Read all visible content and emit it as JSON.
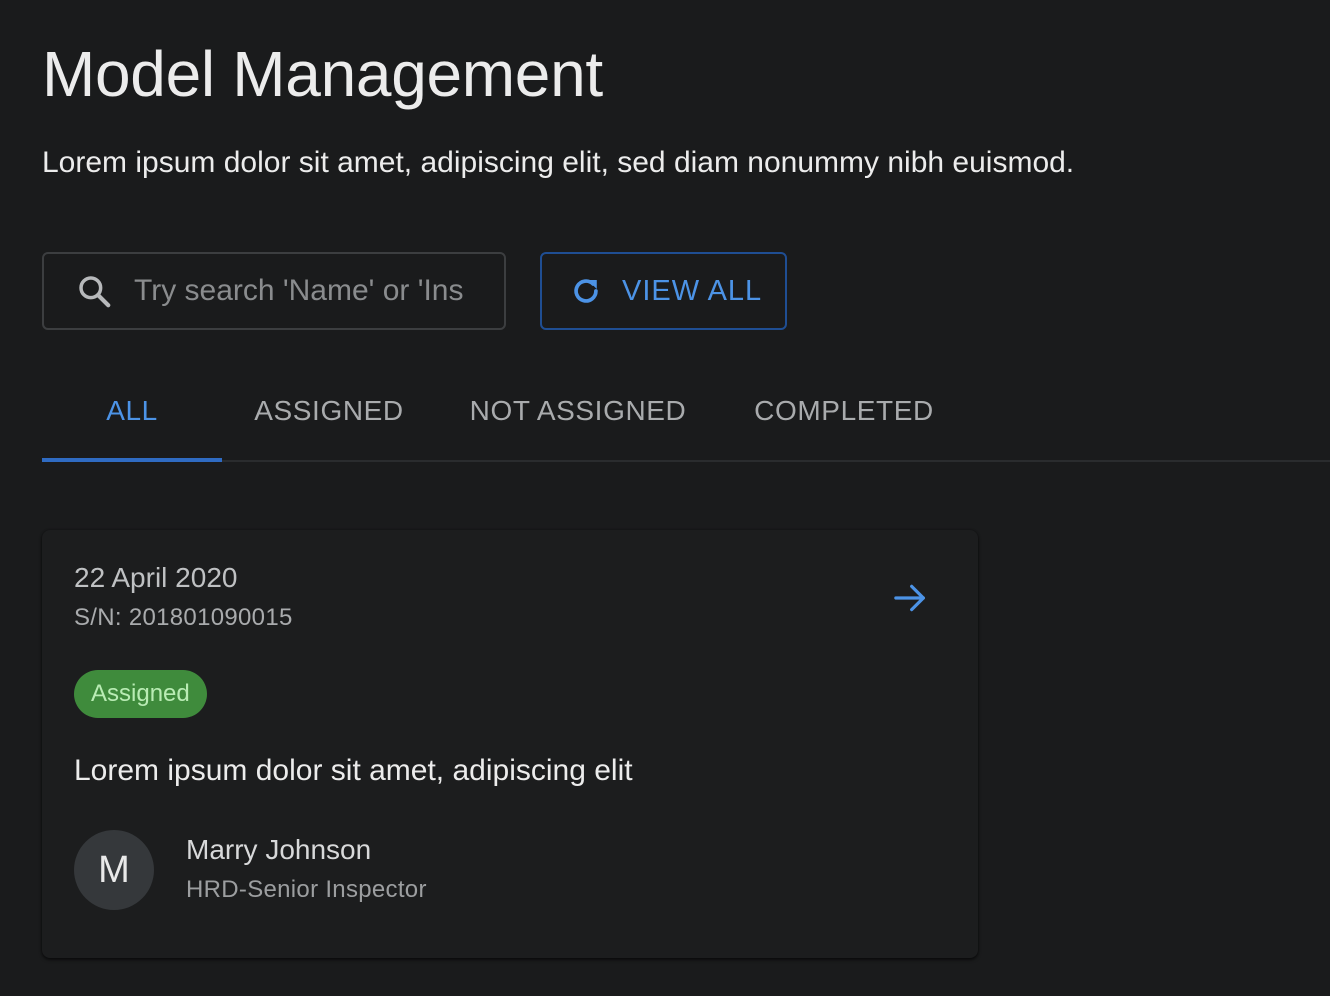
{
  "header": {
    "title": "Model Management",
    "subtitle": "Lorem ipsum dolor sit amet, adipiscing elit, sed diam nonummy nibh euismod."
  },
  "toolbar": {
    "search": {
      "placeholder": "Try search 'Name' or 'Ins",
      "value": "",
      "icon": "search-icon"
    },
    "view_all": {
      "label": "VIEW ALL",
      "icon": "refresh-icon"
    }
  },
  "tabs": {
    "items": [
      {
        "label": "ALL",
        "active": true
      },
      {
        "label": "ASSIGNED",
        "active": false
      },
      {
        "label": "NOT ASSIGNED",
        "active": false
      },
      {
        "label": "COMPLETED",
        "active": false
      }
    ]
  },
  "cards": [
    {
      "date": "22 April 2020",
      "serial": "S/N: 201801090015",
      "status": "Assigned",
      "description": "Lorem ipsum dolor sit amet, adipiscing elit",
      "assignee": {
        "initial": "M",
        "name": "Marry Johnson",
        "role": "HRD-Senior Inspector"
      },
      "action_icon": "arrow-right-icon"
    }
  ],
  "colors": {
    "background": "#1a1b1c",
    "accent": "#4c93e6",
    "tab_indicator": "#2f6bc2",
    "status_assigned_bg": "#3f8b3c",
    "status_assigned_text": "#b9ecb4"
  }
}
